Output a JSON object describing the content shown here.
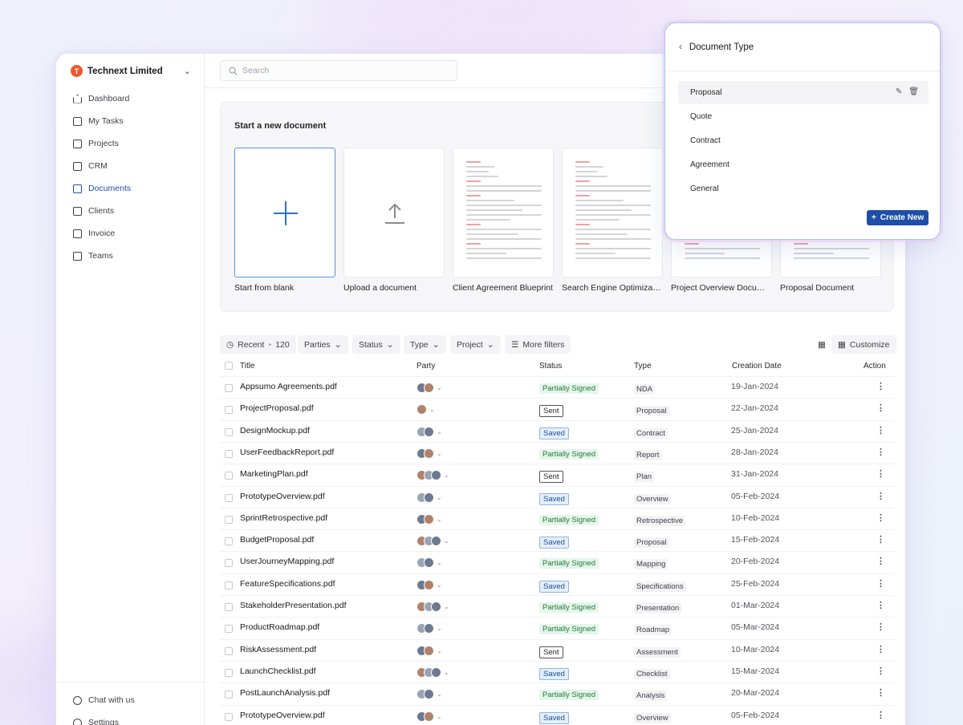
{
  "org": {
    "initial": "T",
    "name": "Technext Limited"
  },
  "nav": [
    {
      "label": "Dashboard",
      "icon": "home-icon"
    },
    {
      "label": "My Tasks",
      "icon": "clipboard-icon"
    },
    {
      "label": "Projects",
      "icon": "projects-icon"
    },
    {
      "label": "CRM",
      "icon": "crm-icon"
    },
    {
      "label": "Documents",
      "icon": "document-icon"
    },
    {
      "label": "Clients",
      "icon": "clients-icon"
    },
    {
      "label": "Invoice",
      "icon": "invoice-icon"
    },
    {
      "label": "Teams",
      "icon": "teams-icon"
    }
  ],
  "bottom_nav": [
    {
      "label": "Chat with us",
      "icon": "headset-icon"
    },
    {
      "label": "Settings",
      "icon": "gear-icon"
    }
  ],
  "search": {
    "placeholder": "Search"
  },
  "new_document": {
    "title": "Start a new document",
    "templates": [
      "Start from blank",
      "Upload a document",
      "Client Agreement Blueprint",
      "Search Engine Optimization",
      "Project Overview Document",
      "Proposal Document"
    ]
  },
  "filters": {
    "recent": "Recent",
    "recent_count": "120",
    "parties": "Parties",
    "status": "Status",
    "type": "Type",
    "project": "Project",
    "more": "More filters",
    "customize": "Customize"
  },
  "table": {
    "headers": {
      "title": "Title",
      "party": "Party",
      "status": "Status",
      "type": "Type",
      "date": "Creation Date",
      "action": "Action"
    },
    "rows": [
      {
        "title": "Appsumo Agreements.pdf",
        "status": "Partially Signed",
        "type": "NDA",
        "date": "19-Jan-2024",
        "avatars": 2
      },
      {
        "title": "ProjectProposal.pdf",
        "status": "Sent",
        "type": "Proposal",
        "date": "22-Jan-2024",
        "avatars": 1
      },
      {
        "title": "DesignMockup.pdf",
        "status": "Saved",
        "type": "Contract",
        "date": "25-Jan-2024",
        "avatars": 2
      },
      {
        "title": "UserFeedbackReport.pdf",
        "status": "Partially Signed",
        "type": "Report",
        "date": "28-Jan-2024",
        "avatars": 2
      },
      {
        "title": "MarketingPlan.pdf",
        "status": "Sent",
        "type": "Plan",
        "date": "31-Jan-2024",
        "avatars": 3
      },
      {
        "title": "PrototypeOverview.pdf",
        "status": "Saved",
        "type": "Overview",
        "date": "05-Feb-2024",
        "avatars": 2
      },
      {
        "title": "SprintRetrospective.pdf",
        "status": "Partially Signed",
        "type": "Retrospective",
        "date": "10-Feb-2024",
        "avatars": 2
      },
      {
        "title": "BudgetProposal.pdf",
        "status": "Saved",
        "type": "Proposal",
        "date": "15-Feb-2024",
        "avatars": 3
      },
      {
        "title": "UserJourneyMapping.pdf",
        "status": "Partially Signed",
        "type": "Mapping",
        "date": "20-Feb-2024",
        "avatars": 2
      },
      {
        "title": "FeatureSpecifications.pdf",
        "status": "Saved",
        "type": "Specifications",
        "date": "25-Feb-2024",
        "avatars": 2
      },
      {
        "title": "StakeholderPresentation.pdf",
        "status": "Partially Signed",
        "type": "Presentation",
        "date": "01-Mar-2024",
        "avatars": 3
      },
      {
        "title": "ProductRoadmap.pdf",
        "status": "Partially Signed",
        "type": "Roadmap",
        "date": "05-Mar-2024",
        "avatars": 2
      },
      {
        "title": "RiskAssessment.pdf",
        "status": "Sent",
        "type": "Assessment",
        "date": "10-Mar-2024",
        "avatars": 2
      },
      {
        "title": "LaunchChecklist.pdf",
        "status": "Saved",
        "type": "Checklist",
        "date": "15-Mar-2024",
        "avatars": 3
      },
      {
        "title": "PostLaunchAnalysis.pdf",
        "status": "Partially Signed",
        "type": "Analysis",
        "date": "20-Mar-2024",
        "avatars": 2
      },
      {
        "title": "PrototypeOverview.pdf",
        "status": "Saved",
        "type": "Overview",
        "date": "05-Feb-2024",
        "avatars": 2
      }
    ]
  },
  "document_type_menu": {
    "title": "Document Type",
    "items": [
      "Proposal",
      "Quote",
      "Contract",
      "Agreement",
      "General"
    ],
    "selected": "Proposal",
    "create_label": "Create New"
  },
  "colors": {
    "accent": "#1d4ea8",
    "org_logo": "#f0562c",
    "partial": "#227a3c",
    "saved": "#1c4f97"
  }
}
